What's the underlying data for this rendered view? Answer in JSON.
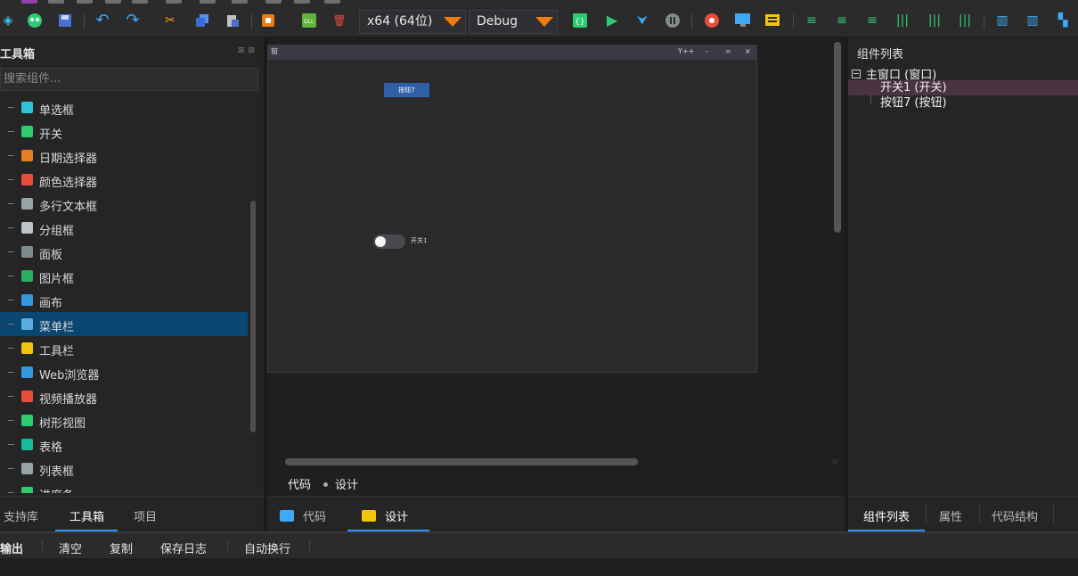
{
  "toolbar": {
    "platform_select": "x64 (64位)",
    "config_select": "Debug",
    "accent": "#f07b0f"
  },
  "toolbox": {
    "title": "工具箱",
    "search_placeholder": "搜索组件...",
    "items": [
      {
        "label": "单选框",
        "icon": "radio-icon",
        "color": "#2ec4d6"
      },
      {
        "label": "开关",
        "icon": "toggle-icon",
        "color": "#2ecc71"
      },
      {
        "label": "日期选择器",
        "icon": "calendar-icon",
        "color": "#e67e22"
      },
      {
        "label": "颜色选择器",
        "icon": "palette-icon",
        "color": "#e74c3c"
      },
      {
        "label": "多行文本框",
        "icon": "textarea-icon",
        "color": "#95a5a6"
      },
      {
        "label": "分组框",
        "icon": "groupbox-icon",
        "color": "#bdc3c7"
      },
      {
        "label": "面板",
        "icon": "panel-icon",
        "color": "#7f8c8d"
      },
      {
        "label": "图片框",
        "icon": "image-icon",
        "color": "#27ae60"
      },
      {
        "label": "画布",
        "icon": "canvas-icon",
        "color": "#3498db"
      },
      {
        "label": "菜单栏",
        "icon": "menubar-icon",
        "color": "#5dade2",
        "selected": true
      },
      {
        "label": "工具栏",
        "icon": "toolbar-icon",
        "color": "#f1c40f"
      },
      {
        "label": "Web浏览器",
        "icon": "globe-icon",
        "color": "#3498db"
      },
      {
        "label": "视频播放器",
        "icon": "video-icon",
        "color": "#e74c3c"
      },
      {
        "label": "树形视图",
        "icon": "tree-icon",
        "color": "#2ecc71"
      },
      {
        "label": "表格",
        "icon": "grid-icon",
        "color": "#1abc9c"
      },
      {
        "label": "列表框",
        "icon": "listbox-icon",
        "color": "#95a5a6"
      },
      {
        "label": "进度条",
        "icon": "progress-icon",
        "color": "#2ecc71"
      }
    ],
    "tabs": [
      "支持库",
      "工具箱",
      "项目"
    ]
  },
  "designer": {
    "window_title": "窗",
    "window_controls": [
      "Y++",
      "-",
      "=",
      "×"
    ],
    "button_label": "按钮7",
    "switch_label": "开关1",
    "mode_code": "代码",
    "mode_design": "设计",
    "tabs": [
      "代码",
      "设计"
    ]
  },
  "components": {
    "title": "组件列表",
    "root": "主窗口 (窗口)",
    "children": [
      "开关1 (开关)",
      "按钮7 (按钮)"
    ],
    "tabs": [
      "组件列表",
      "属性",
      "代码结构"
    ]
  },
  "output": {
    "title": "输出",
    "actions": [
      "清空",
      "复制",
      "保存日志",
      "自动换行"
    ]
  }
}
